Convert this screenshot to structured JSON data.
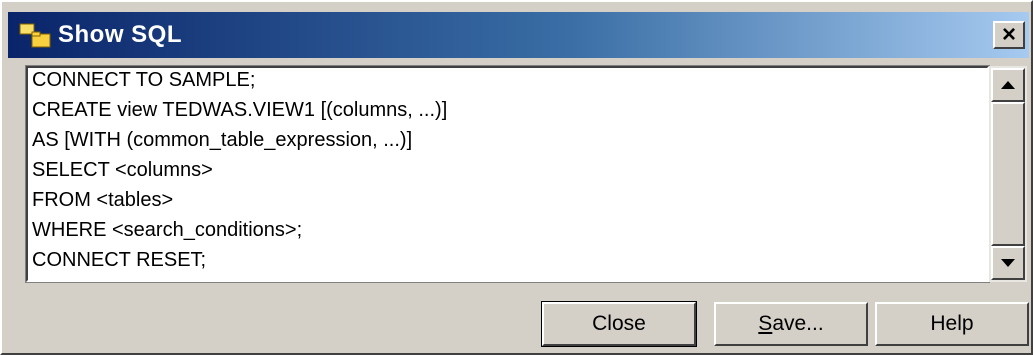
{
  "window": {
    "title": "Show SQL",
    "close_glyph": "×",
    "icon": "folder-icon"
  },
  "sql": {
    "lines": [
      "CONNECT TO SAMPLE;",
      "CREATE view TEDWAS.VIEW1 [(columns, ...)]",
      "AS [WITH (common_table_expression, ...)]",
      "SELECT <columns>",
      "FROM <tables>",
      "WHERE <search_conditions>;",
      "CONNECT RESET;"
    ]
  },
  "buttons": {
    "close_label": "Close",
    "save_label": "Save...",
    "help_label": "Help"
  },
  "colors": {
    "title_bar_start": "#0a246a",
    "title_bar_end": "#a6caf0",
    "dialog_face": "#d4d0c8"
  }
}
